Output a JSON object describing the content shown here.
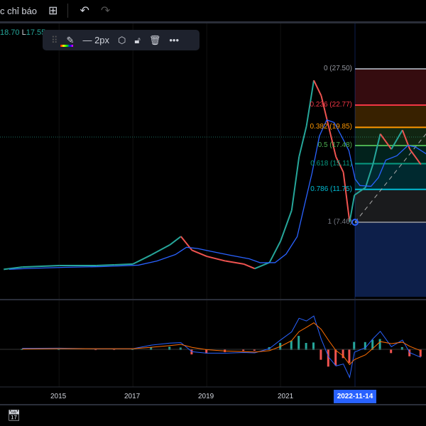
{
  "topbar": {
    "indicators_label": "c chỉ báo",
    "layout_icon": "grid-icon",
    "undo_icon": "undo-icon",
    "redo_icon": "redo-icon"
  },
  "ohlc": {
    "h_value": "18.70",
    "l_label": "L",
    "l_value": "17.55"
  },
  "drawing_toolbar": {
    "width_label": "2px",
    "icons": [
      "drag-handle-icon",
      "pencil-icon",
      "line-width-icon",
      "settings-icon",
      "unlock-icon",
      "trash-icon",
      "more-icon"
    ]
  },
  "fib": {
    "levels": [
      {
        "label": "0 (27.50)",
        "value": 27.5,
        "color": "#9598a1"
      },
      {
        "label": "0.236 (22.77)",
        "value": 22.77,
        "color": "#f23645"
      },
      {
        "label": "0.382 (19.85)",
        "value": 19.85,
        "color": "#ff9800"
      },
      {
        "label": "0.5 (17.48)",
        "value": 17.48,
        "color": "#4caf50"
      },
      {
        "label": "0.618 (15.11)",
        "value": 15.11,
        "color": "#089981"
      },
      {
        "label": "0.786 (11.75)",
        "value": 11.75,
        "color": "#00bcd4"
      },
      {
        "label": "1 (7.46)",
        "value": 7.46,
        "color": "#787b86"
      }
    ]
  },
  "xaxis": {
    "labels": [
      "2015",
      "2017",
      "2019",
      "2021"
    ],
    "label_years": [
      2015,
      2017,
      2019,
      2021
    ],
    "crosshair_date": "2022-11-14"
  },
  "chart_data": {
    "type": "line",
    "price": [
      [
        2013.5,
        1.3
      ],
      [
        2014,
        1.6
      ],
      [
        2015,
        1.8
      ],
      [
        2016,
        1.8
      ],
      [
        2016.5,
        1.9
      ],
      [
        2017,
        2.0
      ],
      [
        2017.5,
        3.2
      ],
      [
        2018,
        4.5
      ],
      [
        2018.3,
        5.6
      ],
      [
        2018.6,
        3.8
      ],
      [
        2019,
        3.0
      ],
      [
        2019.5,
        2.4
      ],
      [
        2020,
        2.0
      ],
      [
        2020.3,
        1.4
      ],
      [
        2020.7,
        2.2
      ],
      [
        2021,
        5
      ],
      [
        2021.3,
        9
      ],
      [
        2021.5,
        16
      ],
      [
        2021.7,
        20
      ],
      [
        2021.9,
        26
      ],
      [
        2022.1,
        24
      ],
      [
        2022.3,
        20
      ],
      [
        2022.5,
        16
      ],
      [
        2022.7,
        14
      ],
      [
        2022.87,
        7.5
      ],
      [
        2023,
        11
      ],
      [
        2023.3,
        12
      ],
      [
        2023.5,
        15
      ],
      [
        2023.7,
        19
      ],
      [
        2024,
        17
      ],
      [
        2024.3,
        19.5
      ],
      [
        2024.5,
        17
      ],
      [
        2024.8,
        15
      ]
    ]
  }
}
